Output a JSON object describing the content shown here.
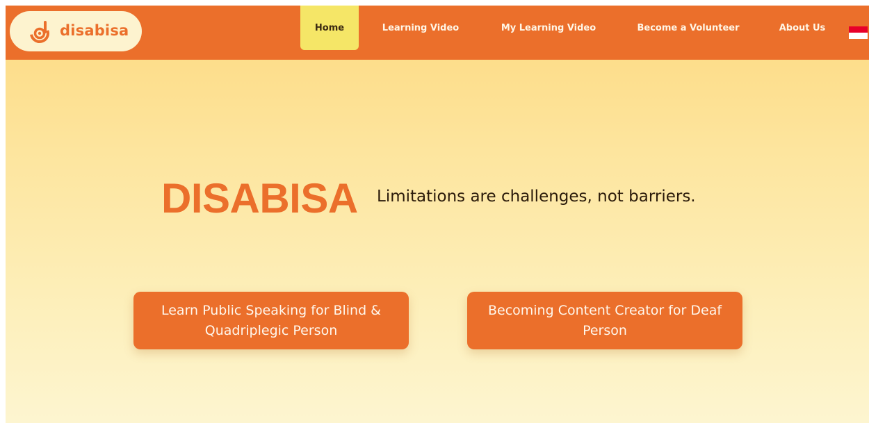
{
  "brand": {
    "name": "disabisa",
    "icon": "disabisa-logo-icon",
    "color": "#eb6f2b"
  },
  "nav": {
    "items": [
      {
        "label": "Home",
        "active": true
      },
      {
        "label": "Learning Video",
        "active": false
      },
      {
        "label": "My Learning Video",
        "active": false
      },
      {
        "label": "Become a Volunteer",
        "active": false
      },
      {
        "label": "About Us",
        "active": false
      }
    ],
    "language_flag": "indonesia-flag-icon"
  },
  "hero": {
    "title": "DISABISA",
    "tagline": "Limitations are challenges, not barriers."
  },
  "actions": {
    "blind_button": "Learn Public Speaking for Blind & Quadriplegic Person",
    "deaf_button": "Becoming Content Creator for Deaf Person"
  },
  "colors": {
    "accent": "#eb6f2b",
    "nav_active": "#f5e667",
    "background_top": "#fdd980",
    "background_bottom": "#fdf5d0"
  }
}
